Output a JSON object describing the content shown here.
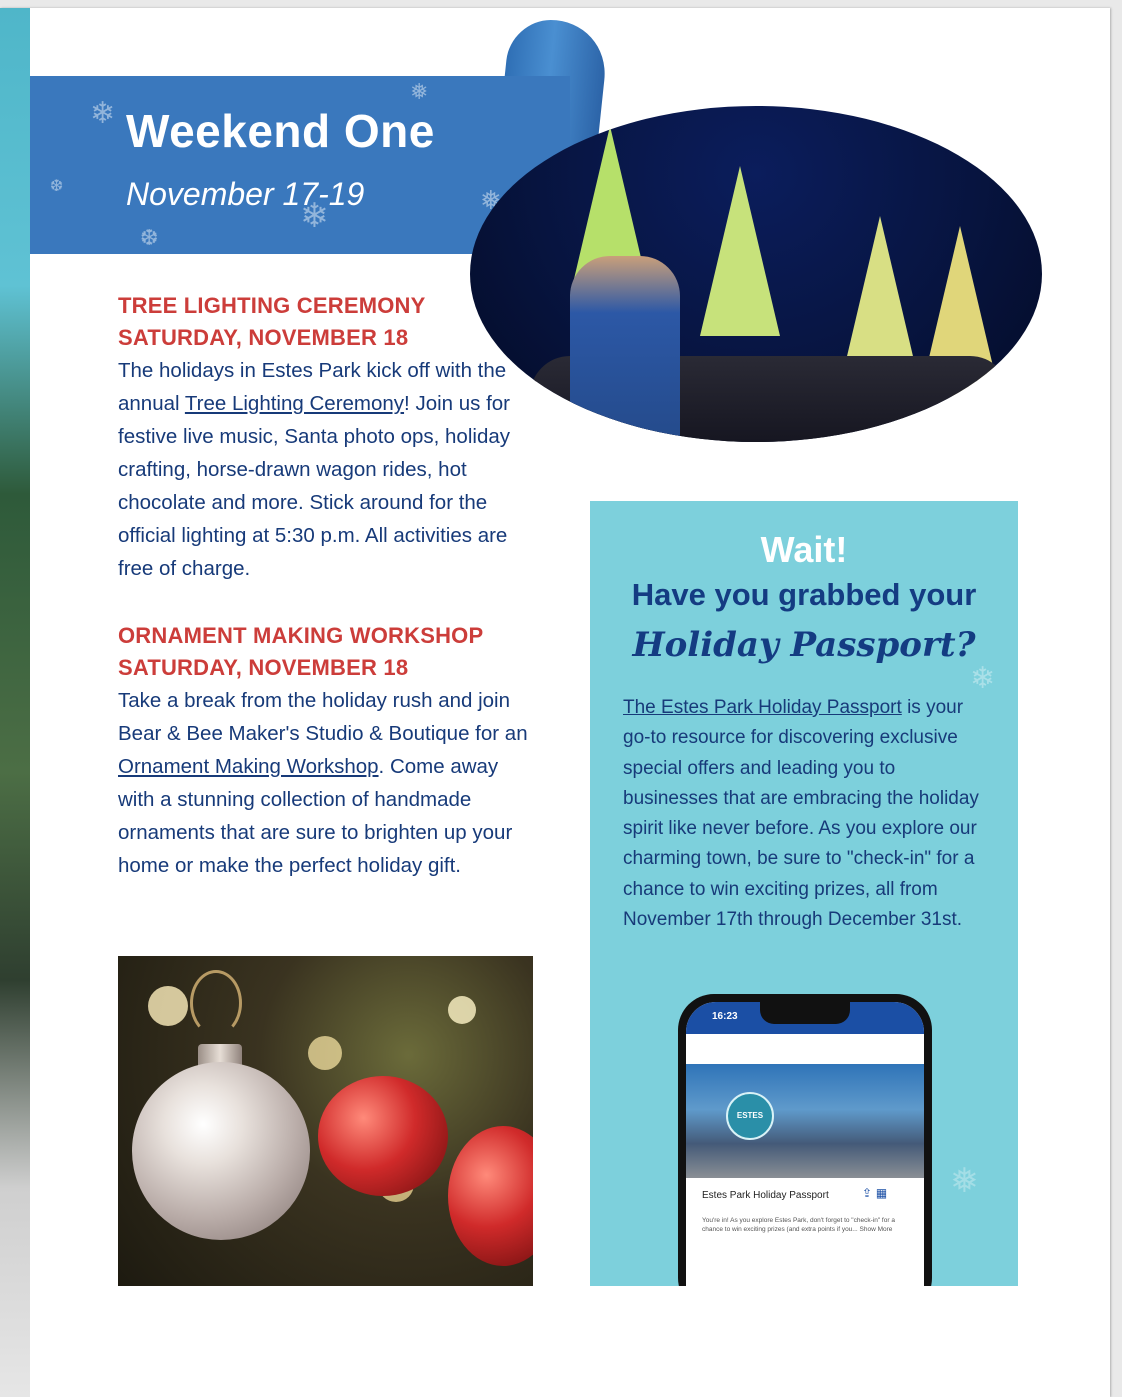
{
  "banner": {
    "title": "Weekend One",
    "dates": "November 17-19"
  },
  "sections": [
    {
      "heading_line1": "TREE LIGHTING CEREMONY",
      "heading_line2": "SATURDAY, NOVEMBER 18",
      "body_before_link": "The holidays in Estes Park kick off with the annual ",
      "link_text": "Tree Lighting Ceremony",
      "body_after_link": "! Join us for festive live music, Santa photo ops, holiday crafting, horse-drawn wagon rides, hot chocolate and more. Stick around for the official lighting at 5:30 p.m. All activities are free of charge."
    },
    {
      "heading_line1": "ORNAMENT MAKING WORKSHOP",
      "heading_line2": "SATURDAY, NOVEMBER 18",
      "body_before_link": "Take a break from the holiday rush and join Bear & Bee Maker's Studio & Boutique for an ",
      "link_text": "Ornament Making Workshop",
      "body_after_link": ". Come away with a stunning collection of handmade ornaments that are sure to brighten up your home or make the perfect holiday gift."
    }
  ],
  "passport": {
    "wait": "Wait!",
    "question": "Have you grabbed your",
    "name": "Holiday Passport?",
    "link_text": "The Estes Park Holiday Passport",
    "body_after_link": " is your go-to resource for discovering exclusive special offers and leading you to businesses that are embracing the holiday spirit like never before. As you explore our charming town, be sure to \"check-in\" for a chance to win exciting prizes, all from November 17th through December 31st."
  },
  "phone": {
    "time": "16:23",
    "badge": "ESTES",
    "app_title": "Estes Park Holiday Passport",
    "app_desc": "You're in! As you explore Estes Park, don't forget to \"check-in\" for a chance to win exciting prizes (and extra points if you... Show More"
  },
  "icons": {
    "snowflake": "snowflake-icon",
    "share": "share-icon",
    "calendar": "calendar-icon"
  },
  "colors": {
    "banner_blue": "#3a78bd",
    "heading_red": "#cc3d3a",
    "body_navy": "#173a79",
    "passport_bg": "#7dd0dc"
  }
}
